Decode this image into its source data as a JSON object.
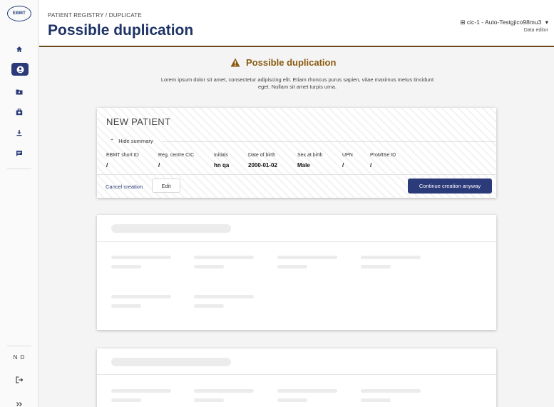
{
  "sidebar": {
    "logo_text": "EBMT",
    "icons": [
      "home-icon",
      "patient-icon",
      "folder-icon",
      "medical-kit-icon",
      "download-icon",
      "chat-icon"
    ],
    "user_initials": "N D",
    "logout_icon": "logout-icon",
    "expand_icon": "expand-icon"
  },
  "header": {
    "breadcrumb": "PATIENT REGISTRY / DUPLICATE",
    "title": "Possible duplication",
    "user_name": "cic-1 - Auto-Testgjico98mu3",
    "user_role": "Data editor"
  },
  "warning": {
    "title": "Possible duplication",
    "text": "Lorem ipsum dolor sit amet, consectetur adipiscing elit. Etiam rhoncus purus sapien, vitae maximus metus tincidunt eget. Nullam sit amet turpis urna.",
    "color": "#8a5a10"
  },
  "patient_card": {
    "title": "NEW PATIENT",
    "toggle_label": "Hide summary",
    "columns": [
      {
        "label": "EBMT short ID",
        "value": "/"
      },
      {
        "label": "Reg. centre CIC",
        "value": "/"
      },
      {
        "label": "Initials",
        "value": "hn qa"
      },
      {
        "label": "Date of birth",
        "value": "2000-01-02"
      },
      {
        "label": "Sex at birth",
        "value": "Male"
      },
      {
        "label": "UPN",
        "value": "/"
      },
      {
        "label": "ProMISe ID",
        "value": "/"
      }
    ],
    "cancel_label": "Cancel creation",
    "edit_label": "Edit",
    "continue_label": "Continue creation anyway"
  },
  "colors": {
    "accent": "#2b3a78",
    "header_rule": "#6b4a1a"
  }
}
